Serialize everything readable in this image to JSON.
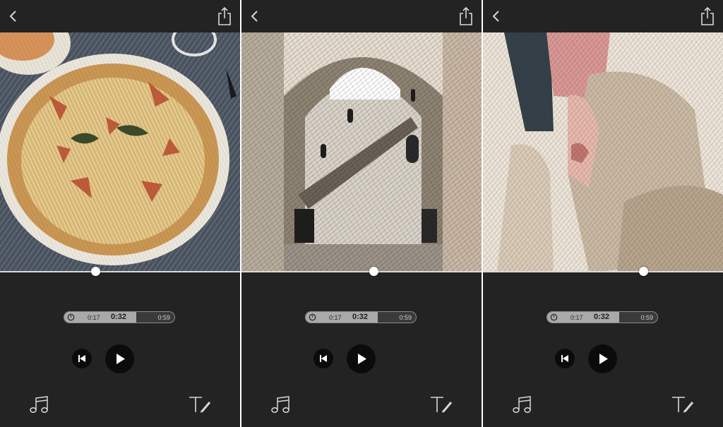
{
  "screens": [
    {
      "subject": "pizza",
      "duration": {
        "min": "0:17",
        "current": "0:32",
        "max": "0:59"
      },
      "icons": {
        "back": "chevron-left-icon",
        "share": "share-icon",
        "timer": "timer-icon",
        "skip": "skip-to-start-icon",
        "play": "play-icon",
        "music": "music-note-icon",
        "text": "text-edit-icon"
      }
    },
    {
      "subject": "archway",
      "duration": {
        "min": "0:17",
        "current": "0:32",
        "max": "0:59"
      },
      "icons": {
        "back": "chevron-left-icon",
        "share": "share-icon",
        "timer": "timer-icon",
        "skip": "skip-to-start-icon",
        "play": "play-icon",
        "music": "music-note-icon",
        "text": "text-edit-icon"
      }
    },
    {
      "subject": "bearded-man",
      "duration": {
        "min": "0:17",
        "current": "0:32",
        "max": "0:59"
      },
      "icons": {
        "back": "chevron-left-icon",
        "share": "share-icon",
        "timer": "timer-icon",
        "skip": "skip-to-start-icon",
        "play": "play-icon",
        "music": "music-note-icon",
        "text": "text-edit-icon"
      }
    }
  ],
  "scrubber_position": [
    0.4,
    0.55,
    0.66
  ],
  "duration_fill_fraction": 0.65,
  "colors": {
    "background": "#232323",
    "scrub_line": "#d9d9d9",
    "button_bg": "#0b0b0b",
    "icon": "#d8d8d8"
  }
}
